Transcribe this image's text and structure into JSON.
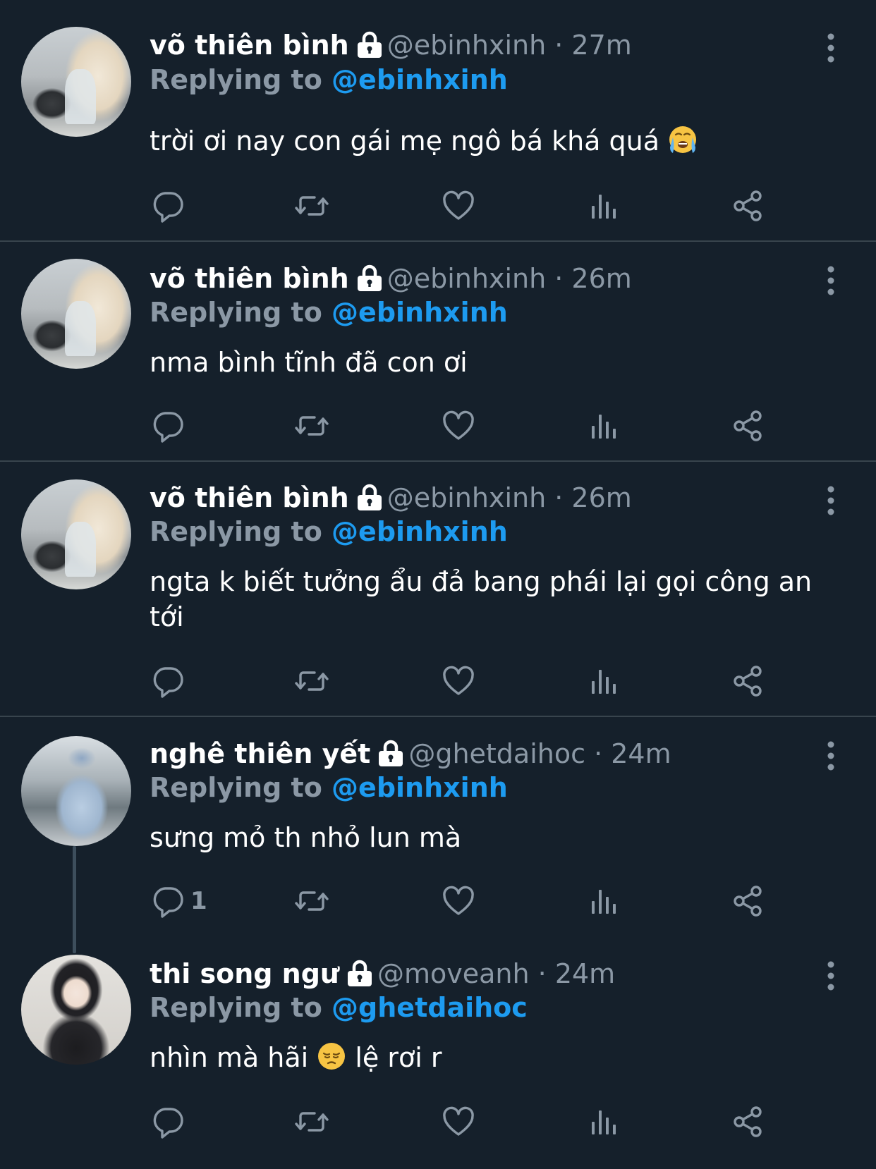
{
  "colors": {
    "background": "#15202b",
    "divider": "#38444d",
    "name": "#ffffff",
    "secondary": "#8b98a5",
    "link": "#1d9bf0"
  },
  "reply_label": "Replying to",
  "tweets": [
    {
      "name": "võ thiên bình",
      "handle_time": "@ebinhxinh · 27m",
      "reply_to": "@ebinhxinh",
      "text": "trời ơi nay con gái mẹ ngô bá khá quá",
      "emoji": "loudly-crying-face-emoji",
      "reply_count": ""
    },
    {
      "name": "võ thiên bình",
      "handle_time": "@ebinhxinh · 26m",
      "reply_to": "@ebinhxinh",
      "text": "nma bình tĩnh đã con ơi",
      "reply_count": ""
    },
    {
      "name": "võ thiên bình",
      "handle_time": "@ebinhxinh · 26m",
      "reply_to": "@ebinhxinh",
      "text": "ngta k biết tưởng ẩu đả bang phái lại gọi công an tới",
      "reply_count": ""
    },
    {
      "name": "nghê thiên yết",
      "handle_time": "@ghetdaihoc · 24m",
      "reply_to": "@ebinhxinh",
      "text": "sưng mỏ th nhỏ lun mà",
      "reply_count": "1"
    },
    {
      "name": "thi song ngư",
      "handle_time": "@moveanh · 24m",
      "reply_to": "@ghetdaihoc",
      "text_before": "nhìn mà hãi",
      "emoji": "pensive-face-emoji",
      "text_after": " lệ rơi r",
      "reply_count": ""
    }
  ],
  "icons": {
    "lock": "lock-icon",
    "more": "more-vertical-icon",
    "reply": "reply-icon",
    "retweet": "retweet-icon",
    "like": "heart-icon",
    "views": "views-icon",
    "share": "share-icon"
  }
}
